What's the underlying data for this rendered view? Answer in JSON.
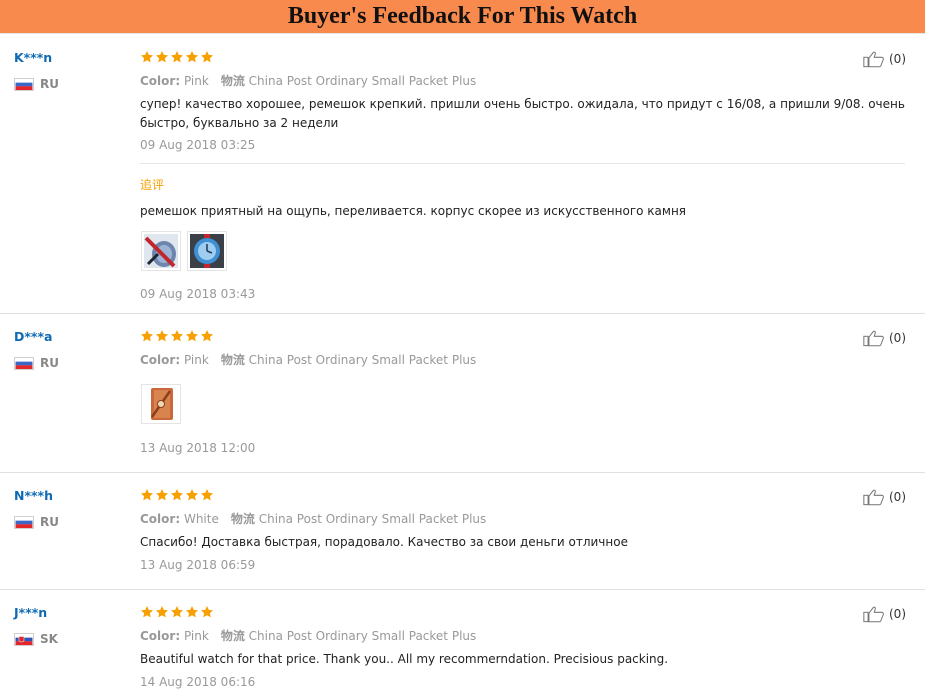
{
  "banner": {
    "title": "Buyer's Feedback For This Watch"
  },
  "labels": {
    "color": "Color:",
    "logistics": "物流",
    "additional": "追评"
  },
  "colors": {
    "banner_bg": "#f98a4e",
    "name": "#0f6ab4",
    "star": "#f7a000",
    "meta": "#999999"
  },
  "reviews": [
    {
      "name": "K***n",
      "country": "RU",
      "rating": 5,
      "color": "Pink",
      "shipping": "China Post Ordinary Small Packet Plus",
      "text": "супер! качество хорошее, ремешок крепкий. пришли очень быстро. ожидала, что придут с 16/08, а пришли 9/08. очень быстро, буквально за 2 недели",
      "date": "09 Aug 2018 03:25",
      "helpful": "(0)",
      "followup": {
        "text": "ремешок приятный на ощупь, переливается. корпус скорее из искусственного камня",
        "date": "09 Aug 2018 03:43"
      }
    },
    {
      "name": "D***a",
      "country": "RU",
      "rating": 5,
      "color": "Pink",
      "shipping": "China Post Ordinary Small Packet Plus",
      "date": "13 Aug 2018 12:00",
      "helpful": "(0)"
    },
    {
      "name": "N***h",
      "country": "RU",
      "rating": 5,
      "color": "White",
      "shipping": "China Post Ordinary Small Packet Plus",
      "text": "Спасибо! Доставка быстрая, порадовало. Качество за свои деньги отличное",
      "date": "13 Aug 2018 06:59",
      "helpful": "(0)"
    },
    {
      "name": "J***n",
      "country": "SK",
      "rating": 5,
      "color": "Pink",
      "shipping": "China Post Ordinary Small Packet Plus",
      "text": "Beautiful watch for that price. Thank you.. All my recommerndation. Precisious packing.",
      "date": "14 Aug 2018 06:16",
      "helpful": "(0)"
    }
  ]
}
